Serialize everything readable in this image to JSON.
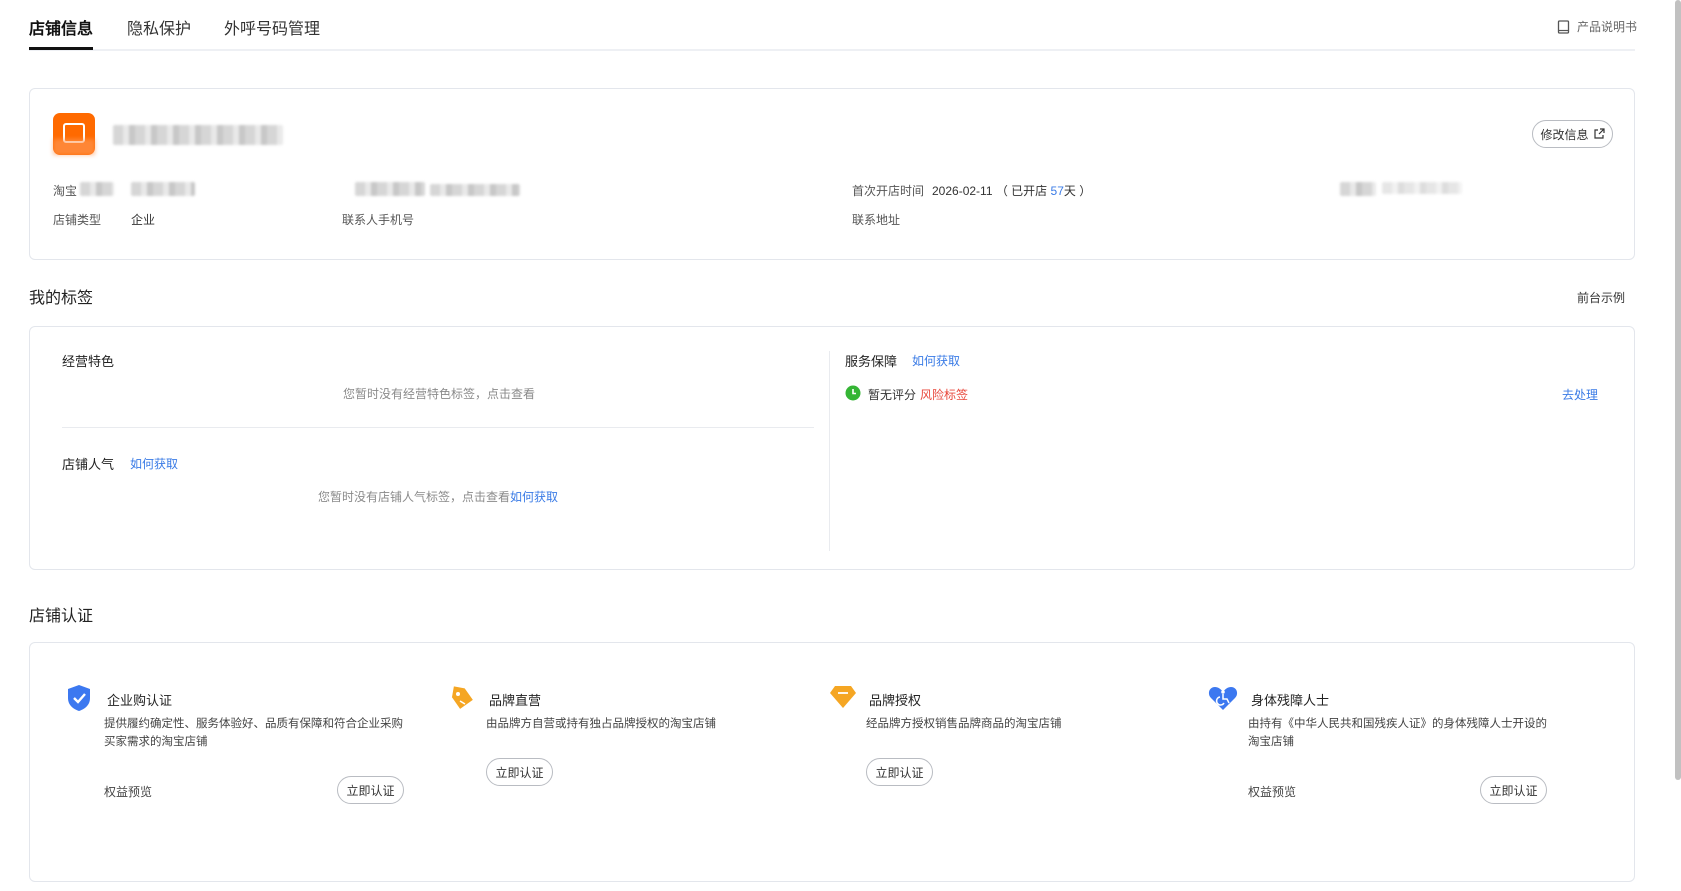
{
  "tabs": [
    {
      "label": "店铺信息",
      "active": true
    },
    {
      "label": "隐私保护",
      "active": false
    },
    {
      "label": "外呼号码管理",
      "active": false
    }
  ],
  "manual_link": {
    "label": "产品说明书",
    "icon": "book-icon"
  },
  "shop": {
    "edit_label": "修改信息",
    "fields": {
      "taobao_label": "淘宝",
      "shop_type_label": "店铺类型",
      "shop_type_value": "企业",
      "contact_phone_label": "联系人手机号",
      "open_time_label": "首次开店时间",
      "open_date": "2026-02-11",
      "open_prefix": "（ 已开店 ",
      "open_days": "57",
      "open_suffix": "天 ）",
      "address_label": "联系地址"
    }
  },
  "my_tags": {
    "title": "我的标签",
    "example_link": "前台示例",
    "business": {
      "title": "经营特色",
      "empty": "您暂时没有经营特色标签，点击查看"
    },
    "popularity": {
      "title": "店铺人气",
      "how_link": "如何获取",
      "empty_prefix": "您暂时没有店铺人气标签，点击查看",
      "empty_link": "如何获取"
    },
    "service": {
      "title": "服务保障",
      "how_link": "如何获取",
      "status": "暂无评分",
      "risk": "风险标签",
      "action": "去处理"
    }
  },
  "certification": {
    "title": "店铺认证",
    "items": [
      {
        "title": "企业购认证",
        "desc": "提供履约确定性、服务体验好、品质有保障和符合企业采购买家需求的淘宝店铺",
        "preview": "权益预览",
        "button": "立即认证",
        "icon": "shield-check-icon",
        "color": "#3c78f0"
      },
      {
        "title": "品牌直营",
        "desc": "由品牌方自营或持有独占品牌授权的淘宝店铺",
        "preview": "",
        "button": "立即认证",
        "icon": "tag-icon",
        "color": "#f5a623"
      },
      {
        "title": "品牌授权",
        "desc": "经品牌方授权销售品牌商品的淘宝店铺",
        "preview": "",
        "button": "立即认证",
        "icon": "diamond-icon",
        "color": "#f5a623"
      },
      {
        "title": "身体残障人士",
        "desc": "由持有《中华人民共和国残疾人证》的身体残障人士开设的淘宝店铺",
        "preview": "权益预览",
        "button": "立即认证",
        "icon": "heart-accessibility-icon",
        "color": "#3c78f0"
      }
    ]
  },
  "colors": {
    "link": "#3a7be6",
    "risk": "#e8483c",
    "ok": "#35b535",
    "brand": "#ff6a00"
  }
}
